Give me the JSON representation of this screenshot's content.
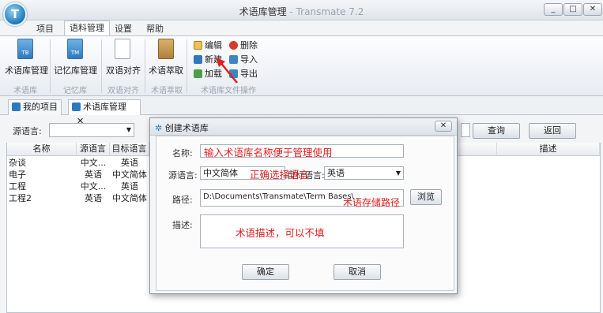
{
  "window": {
    "title": "术语库管理",
    "subtitle": " - Transmate 7.2",
    "logo_text": "T",
    "minimize": "_",
    "maximize": "□",
    "close": "✕"
  },
  "menu_tabs": [
    "项目",
    "语料管理",
    "设置",
    "帮助"
  ],
  "ribbon": {
    "buttons": [
      {
        "label": "术语库管理",
        "icon": "TB"
      },
      {
        "label": "记忆库管理",
        "icon": "TM"
      },
      {
        "label": "双语对齐",
        "icon": ""
      },
      {
        "label": "术语萃取",
        "icon": ""
      }
    ],
    "small_buttons": {
      "edit": "编辑",
      "delete": "删除",
      "new": "新建",
      "import": "导入",
      "load": "加载",
      "export": "导出"
    },
    "groups": [
      "术语库",
      "记忆库",
      "双语对齐",
      "术语萃取",
      "术语库文件操作"
    ]
  },
  "doc_tabs": [
    {
      "label": "我的项目"
    },
    {
      "label": "术语库管理",
      "close": "✕"
    }
  ],
  "search": {
    "source_label": "源语言:",
    "query_button": "查询",
    "back_button": "返回"
  },
  "table": {
    "headers": [
      "名称",
      "源语言",
      "目标语言",
      "描述"
    ],
    "rows": [
      [
        "杂谈",
        "中文...",
        "英语"
      ],
      [
        "电子",
        "英语",
        "中文简体"
      ],
      [
        "工程",
        "中文...",
        "英语"
      ],
      [
        "工程2",
        "英语",
        "中文简体"
      ]
    ]
  },
  "dialog": {
    "title": "创建术语库",
    "close": "✕",
    "name_label": "名称:",
    "source_label": "源语言:",
    "source_value": "中文简体",
    "target_label": "目标语言:",
    "target_value": "英语",
    "path_label": "路径:",
    "path_value": "D:\\Documents\\Transmate\\Term Bases\\",
    "browse_button": "浏览",
    "desc_label": "描述:",
    "ok_button": "确定",
    "cancel_button": "取消"
  },
  "annotations": {
    "name_hint": "输入术语库名称便于管理使用",
    "language_hint": "正确选择语言",
    "path_hint": "术语存储路径",
    "desc_hint": "术语描述，可以不填"
  },
  "colors": {
    "annotation": "#e02020",
    "accent": "#2c79bd"
  }
}
